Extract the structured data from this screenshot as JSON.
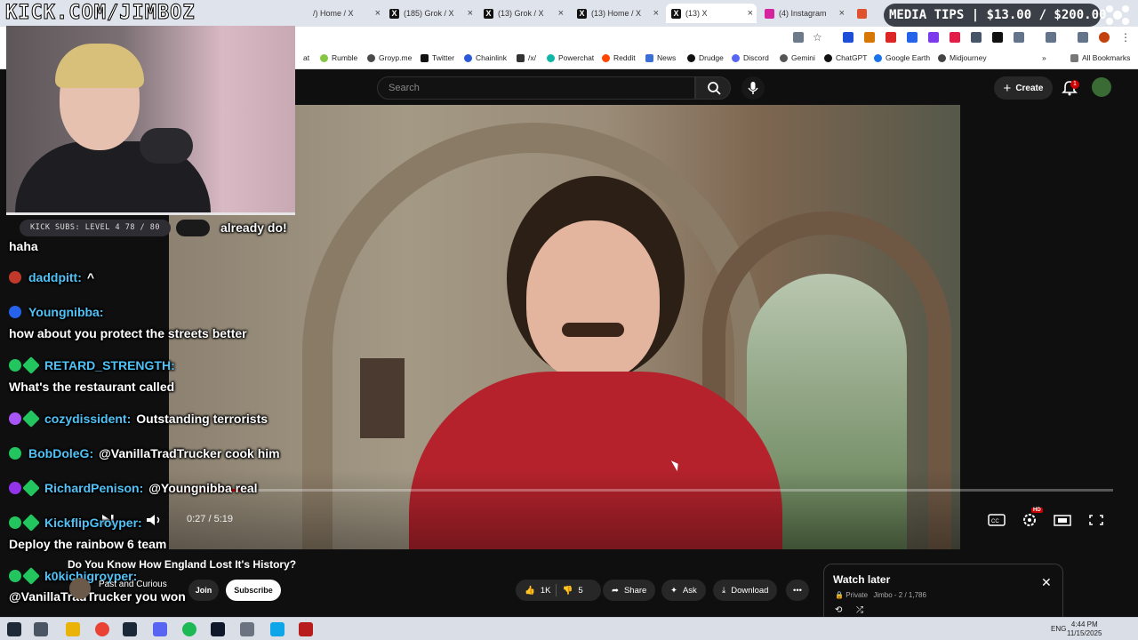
{
  "stream": {
    "logo_text": "KICK.COM/JIMBOZ",
    "kick_subs": "KICK SUBS: LEVEL 4 78 / 80",
    "media_tips": "MEDIA TIPS | $13.00 / $200.00"
  },
  "browser": {
    "tabs": [
      {
        "label": "/) Home / X",
        "icon": "x-logo-icon"
      },
      {
        "label": "(185) Grok / X",
        "icon": "x-logo-icon"
      },
      {
        "label": "(13) Grok / X",
        "icon": "x-logo-icon"
      },
      {
        "label": "(13) Home / X",
        "icon": "x-logo-icon"
      },
      {
        "label": "(13) X",
        "icon": "x-logo-icon"
      },
      {
        "label": "(4) Instagram",
        "icon": "instagram-icon"
      }
    ],
    "bookmarks": [
      {
        "label": "at",
        "color": "#888888"
      },
      {
        "label": "Rumble",
        "color": "#85c742"
      },
      {
        "label": "Groyp.me",
        "color": "#4a4a4a"
      },
      {
        "label": "Twitter",
        "color": "#111111"
      },
      {
        "label": "Chainlink",
        "color": "#2a5ada"
      },
      {
        "label": "/x/",
        "color": "#333333"
      },
      {
        "label": "Powerchat",
        "color": "#12b6a6"
      },
      {
        "label": "Reddit",
        "color": "#ff4500"
      },
      {
        "label": "News",
        "color": "#3b6fd8"
      },
      {
        "label": "Drudge",
        "color": "#111111"
      },
      {
        "label": "Discord",
        "color": "#5865f2"
      },
      {
        "label": "Gemini",
        "color": "#555555"
      },
      {
        "label": "ChatGPT",
        "color": "#111111"
      },
      {
        "label": "Google Earth",
        "color": "#1a73e8"
      },
      {
        "label": "Midjourney",
        "color": "#444444"
      }
    ],
    "all_bookmarks": "All Bookmarks"
  },
  "youtube": {
    "search_placeholder": "Search",
    "create_label": "Create",
    "notification_count": "1",
    "video_title": "Do You Know How England Lost It's History?",
    "channel_name": "Past and Curious",
    "join_label": "Join",
    "subscribe_label": "Subscribe",
    "likes": "1K",
    "dislikes": "5",
    "share_label": "Share",
    "ask_label": "Ask",
    "download_label": "Download",
    "time_display": "0:27 / 5:19",
    "progress_fraction": 0.085,
    "hd_badge": "HD",
    "watch_later": {
      "title": "Watch later",
      "privacy": "Private",
      "meta": "Jimbo - 2 / 1,786"
    }
  },
  "chat": [
    {
      "user": "",
      "text": "already do!",
      "badges": []
    },
    {
      "user": "",
      "text": "haha",
      "badges": []
    },
    {
      "user": "daddpitt:",
      "text": "^",
      "color": "#4fc3f7",
      "badges": [
        "red-circle-icon"
      ]
    },
    {
      "user": "Youngnibba:",
      "text": "",
      "color": "#4fc3f7",
      "badges": [
        "blue-circle-icon"
      ]
    },
    {
      "user": "",
      "text": "how about you protect the streets better",
      "badges": []
    },
    {
      "user": "RETARD_STRENGTH:",
      "text": "",
      "color": "#4fc3f7",
      "badges": [
        "kick-icon",
        "green-diamond-icon"
      ]
    },
    {
      "user": "",
      "text": "What's the restaurant called",
      "badges": []
    },
    {
      "user": "cozydissident:",
      "text": "Outstanding terrorists",
      "color": "#4fc3f7",
      "badges": [
        "purple-face-icon",
        "green-diamond-icon"
      ]
    },
    {
      "user": "BobDoleG:",
      "text": "@VanillaTradTrucker cook him",
      "color": "#4fc3f7",
      "badges": [
        "kick-icon"
      ]
    },
    {
      "user": "RichardPenison:",
      "text": "@Youngnibba real",
      "color": "#4fc3f7",
      "badges": [
        "purple-circle-icon",
        "green-diamond-icon"
      ]
    },
    {
      "user": "KickflipGroyper:",
      "text": "",
      "color": "#4fc3f7",
      "badges": [
        "kick-icon",
        "green-diamond-icon"
      ]
    },
    {
      "user": "",
      "text": "Deploy the rainbow 6 team",
      "badges": []
    },
    {
      "user": "k0kichigroyper:",
      "text": "",
      "color": "#4fc3f7",
      "badges": [
        "kick-icon",
        "green-diamond-icon"
      ]
    },
    {
      "user": "",
      "text": "@VanillaTradTrucker you won",
      "badges": []
    }
  ],
  "taskbar": {
    "lang": "ENG",
    "time": "4:44 PM",
    "date": "11/15/2025"
  }
}
